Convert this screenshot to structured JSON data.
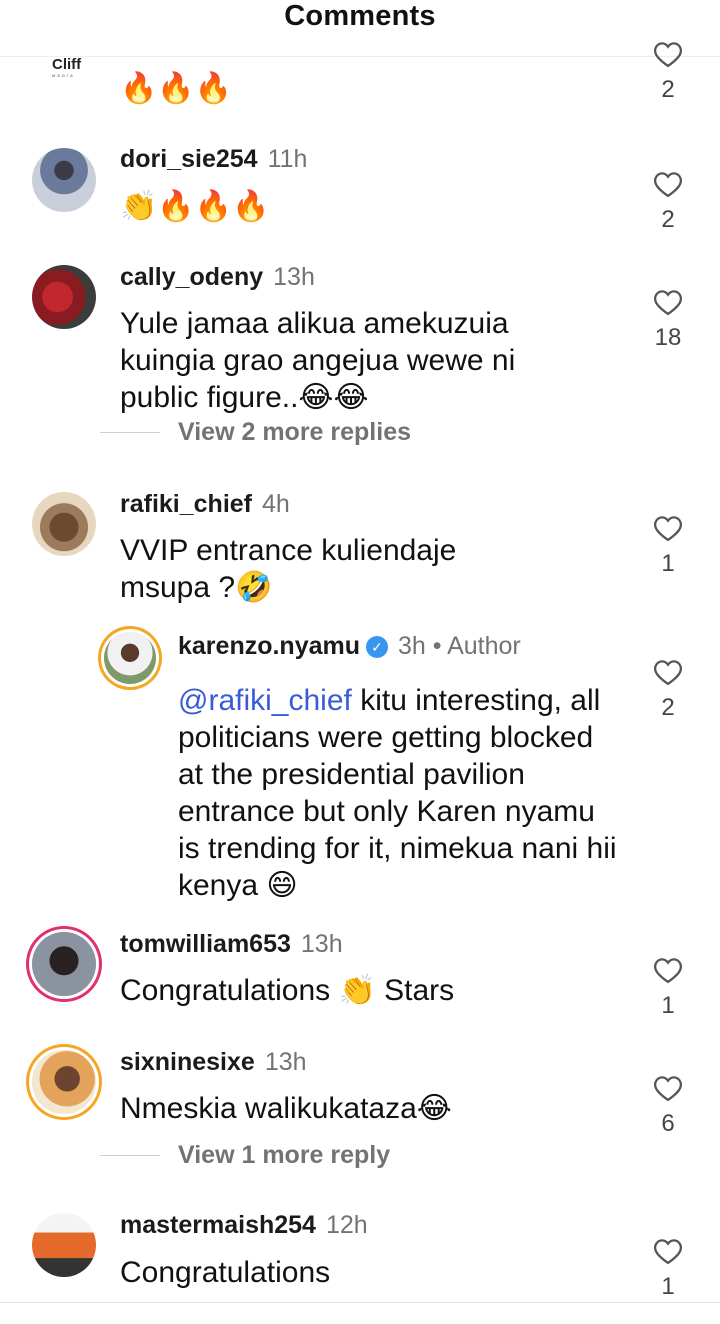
{
  "header": {
    "title": "Comments"
  },
  "colors": {
    "mention": "#3a5bd8",
    "ring": "#e1306c",
    "verified": "#3797f0"
  },
  "top_comment": {
    "logo": "Cliff",
    "text": "🔥🔥🔥",
    "likes": "2"
  },
  "comments": [
    {
      "user": "dori_sie254",
      "time": "11h",
      "text": "👏🔥🔥🔥",
      "likes": "2"
    },
    {
      "user": "cally_odeny",
      "time": "13h",
      "text": "Yule jamaa alikua amekuzuia kuingia grao angejua wewe ni public figure..😂😂",
      "likes": "18",
      "replies": "View 2 more replies"
    },
    {
      "user": "rafiki_chief",
      "time": "4h",
      "text": "VVIP entrance kuliendaje msupa ?🤣",
      "likes": "1"
    },
    {
      "user": "tomwilliam653",
      "time": "13h",
      "text": "Congratulations 👏 Stars",
      "likes": "1"
    },
    {
      "user": "sixninesixe",
      "time": "13h",
      "text": "Nmeskia walikukataza😂",
      "likes": "6",
      "replies": "View 1 more reply"
    },
    {
      "user": "mastermaish254",
      "time": "12h",
      "text": "Congratulations",
      "likes": "1"
    }
  ],
  "reply": {
    "user": "karenzo.nyamu",
    "time": "3h",
    "author_label": "• Author",
    "mention": "@rafiki_chief",
    "text": " kitu interesting, all politicians were getting blocked at the presidential pavilion entrance but only Karen nyamu is trending for it, nimekua nani hii kenya 😄",
    "likes": "2"
  },
  "icons": {
    "like": "heart-outline-icon",
    "verified": "verified-badge-icon"
  }
}
